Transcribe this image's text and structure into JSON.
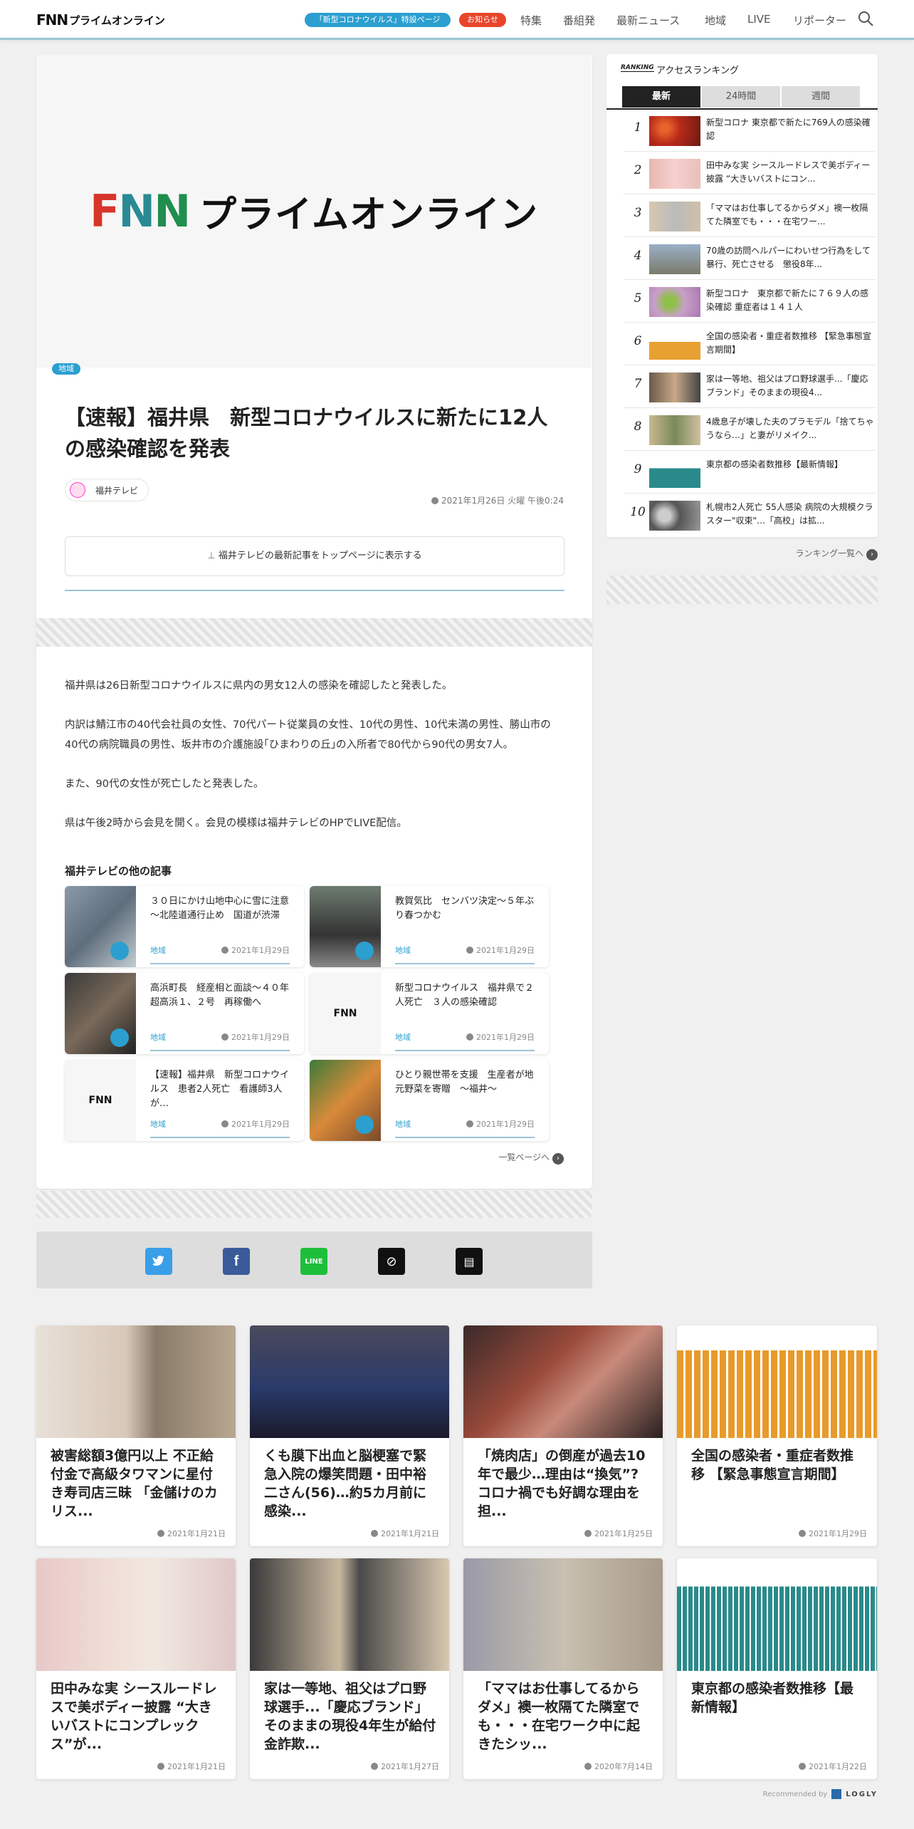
{
  "header": {
    "logo_fnn": "FNN",
    "logo_jp": "プライムオンライン",
    "corona_label": "「新型コロナウイルス」特設ページ",
    "notice_label": "お知らせ",
    "nav": [
      "特集",
      "番組発",
      "最新ニュース",
      "地域",
      "LIVE",
      "リポーター"
    ]
  },
  "article": {
    "hero_fnn": "FNN",
    "hero_jp": "プライムオンライン",
    "category": "地域",
    "title": "【速報】福井県　新型コロナウイルスに新たに12人の感染確認を発表",
    "source": "福井テレビ",
    "date": "2021年1月26日 火曜 午後0:24",
    "pin_label": "福井テレビの最新記事をトップページに表示する",
    "paragraphs": [
      "福井県は26日新型コロナウイルスに県内の男女12人の感染を確認したと発表した。",
      "内訳は鯖江市の40代会社員の女性、70代パート従業員の女性、10代の男性、10代未満の男性、勝山市の40代の病院職員の男性、坂井市の介護施設｢ひまわりの丘｣の入所者で80代から90代の男女7人。",
      "また、90代の女性が死亡したと発表した。",
      "県は午後2時から会見を開く。会見の模様は福井テレビのHPでLIVE配信。"
    ],
    "related_heading": "福井テレビの他の記事",
    "related": [
      {
        "title": "３０日にかけ山地中心に雪に注意～北陸道通行止め　国道が渋滞",
        "category": "地域",
        "date": "2021年1月29日"
      },
      {
        "title": "教賀気比　センバツ決定～５年ぶり春つかむ",
        "category": "地域",
        "date": "2021年1月29日"
      },
      {
        "title": "高浜町長　経産相と面談～４０年超高浜１、２号　再稼働へ",
        "category": "地域",
        "date": "2021年1月29日"
      },
      {
        "title": "新型コロナウイルス　福井県で２人死亡　３人の感染確認",
        "category": "地域",
        "date": "2021年1月29日"
      },
      {
        "title": "【速報】福井県　新型コロナウイルス　患者2人死亡　看護師3人が…",
        "category": "地域",
        "date": "2021年1月29日"
      },
      {
        "title": "ひとり親世帯を支援　生産者が地元野菜を寄贈　～福井～",
        "category": "地域",
        "date": "2021年1月29日"
      }
    ],
    "more_label": "一覧ページへ"
  },
  "ranking": {
    "badge": "RANKING",
    "heading": "アクセスランキング",
    "tabs": [
      "最新",
      "24時間",
      "週間"
    ],
    "items": [
      {
        "rank": "1",
        "title": "新型コロナ 東京都で新たに769人の感染確認"
      },
      {
        "rank": "2",
        "title": "田中みな実 シースルードレスで美ボディー披露 “大きいバストにコン..."
      },
      {
        "rank": "3",
        "title": "「ママはお仕事してるからダメ」襖一枚隔てた隣室でも・・・在宅ワー..."
      },
      {
        "rank": "4",
        "title": "70歳の訪問ヘルパーにわいせつ行為をして暴行、死亡させる　懲役8年..."
      },
      {
        "rank": "5",
        "title": "新型コロナ　東京都で新たに７６９人の感染確認 重症者は１４１人"
      },
      {
        "rank": "6",
        "title": "全国の感染者・重症者数推移 【緊急事態宣言期間】"
      },
      {
        "rank": "7",
        "title": "家は一等地、祖父はプロ野球選手...「慶応ブランド」そのままの現役4..."
      },
      {
        "rank": "8",
        "title": "4歳息子が壊した夫のプラモデル「捨てちゃうなら…」と妻がリメイク..."
      },
      {
        "rank": "9",
        "title": "東京都の感染者数推移【最新情報】"
      },
      {
        "rank": "10",
        "title": "札幌市2人死亡 55人感染 病院の大規模クラスター\"収束\"…「高校」は拡..."
      }
    ],
    "more_label": "ランキング一覧へ"
  },
  "recommend": {
    "cards": [
      {
        "title": "被害総額3億円以上 不正給付金で高級タワマンに星付き寿司店三昧 「金儲けのカリス...",
        "date": "2021年1月21日"
      },
      {
        "title": "くも膜下出血と脳梗塞で緊急入院の爆笑問題・田中裕二さん(56)…約5カ月前に感染...",
        "date": "2021年1月21日"
      },
      {
        "title": "「焼肉店」の倒産が過去10年で最少…理由は“換気”? コロナ禍でも好調な理由を担...",
        "date": "2021年1月25日"
      },
      {
        "title": "全国の感染者・重症者数推移 【緊急事態宣言期間】",
        "date": "2021年1月29日"
      },
      {
        "title": "田中みな実 シースルードレスで美ボディー披露 “大きいバストにコンプレックス”が...",
        "date": "2021年1月21日"
      },
      {
        "title": "家は一等地、祖父はプロ野球選手...「慶応ブランド」そのままの現役4年生が給付金詐欺...",
        "date": "2021年1月27日"
      },
      {
        "title": "「ママはお仕事してるからダメ」襖一枚隔てた隣室でも・・・在宅ワーク中に起きたシッ...",
        "date": "2020年7月14日"
      },
      {
        "title": "東京都の感染者数推移【最新情報】",
        "date": "2021年1月22日"
      }
    ],
    "recommended_by": "Recommended by",
    "logly": "LOGLY"
  }
}
